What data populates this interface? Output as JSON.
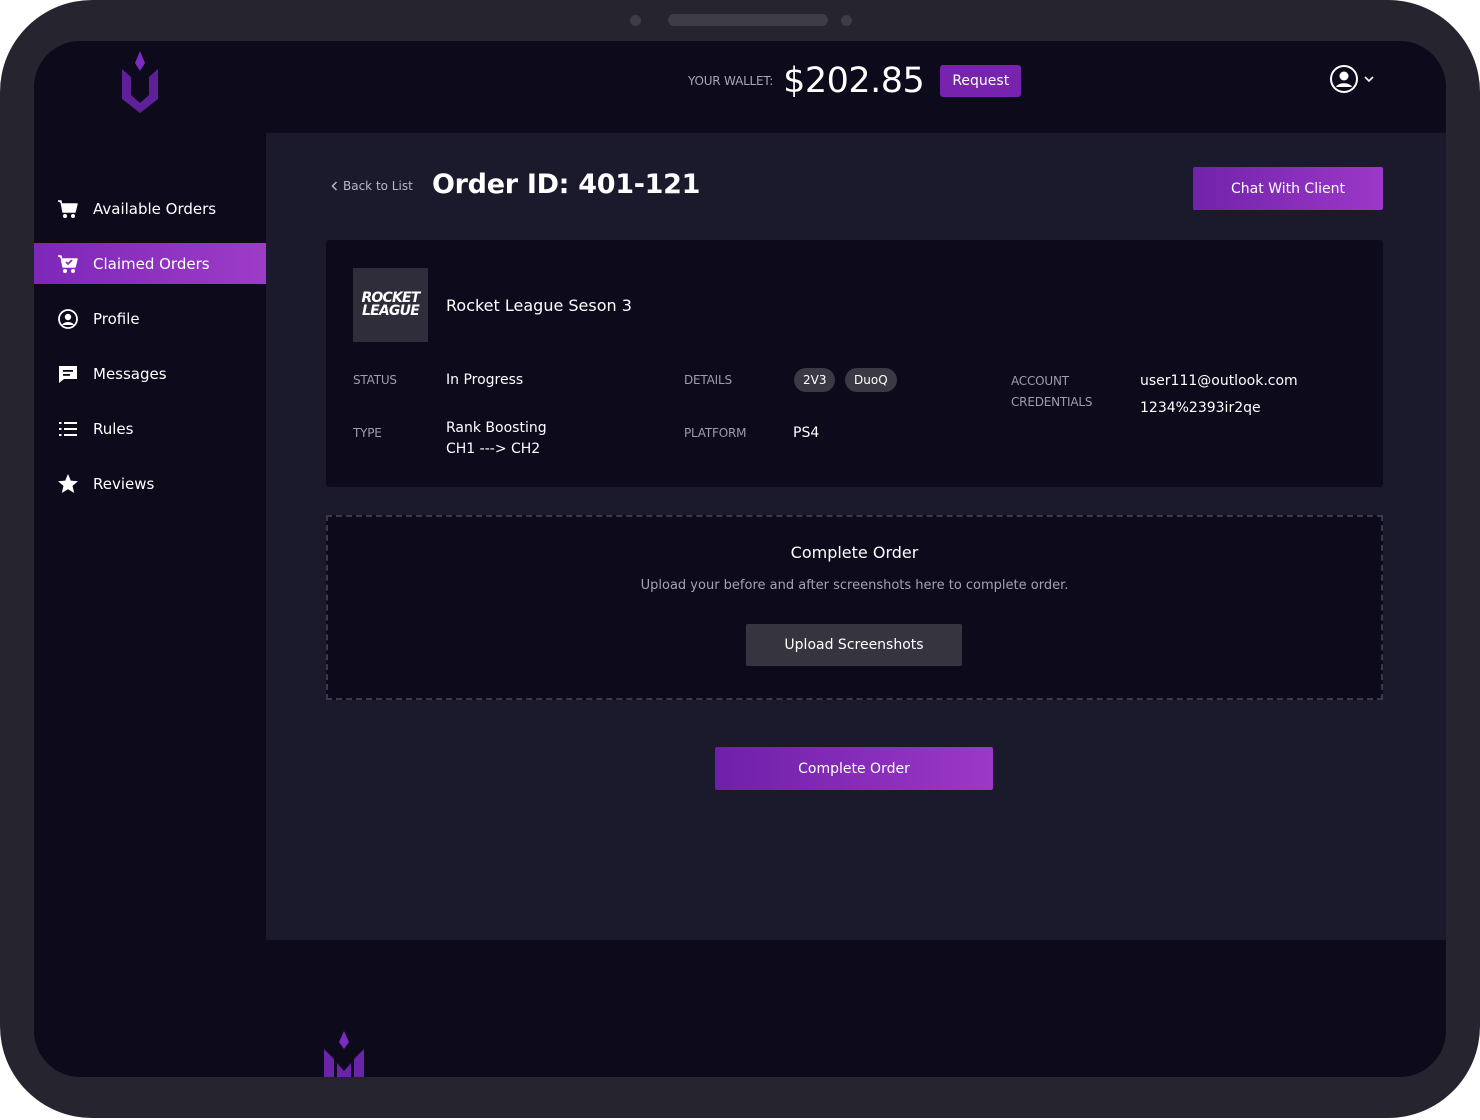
{
  "header": {
    "wallet_label": "YOUR WALLET:",
    "wallet_amount": "$202.85",
    "request_label": "Request"
  },
  "sidebar": {
    "items": [
      {
        "label": "Available Orders",
        "icon": "cart-icon",
        "active": false
      },
      {
        "label": "Claimed Orders",
        "icon": "cart-check-icon",
        "active": true
      },
      {
        "label": "Profile",
        "icon": "user-circle-icon",
        "active": false
      },
      {
        "label": "Messages",
        "icon": "message-icon",
        "active": false
      },
      {
        "label": "Rules",
        "icon": "list-icon",
        "active": false
      },
      {
        "label": "Reviews",
        "icon": "star-icon",
        "active": false
      }
    ]
  },
  "order": {
    "back_label": "Back to List",
    "title": "Order ID: 401-121",
    "chat_label": "Chat With Client",
    "game_logo_line1": "ROCKET",
    "game_logo_line2": "LEAGUE",
    "game_name": "Rocket League Seson 3",
    "status_label": "STATUS",
    "status_value": "In Progress",
    "type_label": "TYPE",
    "type_value_line1": "Rank Boosting",
    "type_value_line2": "CH1 ---> CH2",
    "details_label": "DETAILS",
    "details_tags": [
      "2V3",
      "DuoQ"
    ],
    "platform_label": "PLATFORM",
    "platform_value": "PS4",
    "credentials_label_line1": "ACCOUNT",
    "credentials_label_line2": "CREDENTIALS",
    "credentials_email": "user111@outlook.com",
    "credentials_password": "1234%2393ir2qe"
  },
  "upload": {
    "title": "Complete Order",
    "description": "Upload your before and after screenshots here to complete order.",
    "button_label": "Upload Screenshots"
  },
  "footer": {
    "complete_label": "Complete Order"
  },
  "colors": {
    "accent": "#9c38c7",
    "accent_dark": "#7123ab",
    "background": "#0c0a1b",
    "panel": "#1b1a2c",
    "frame": "#26252f"
  }
}
